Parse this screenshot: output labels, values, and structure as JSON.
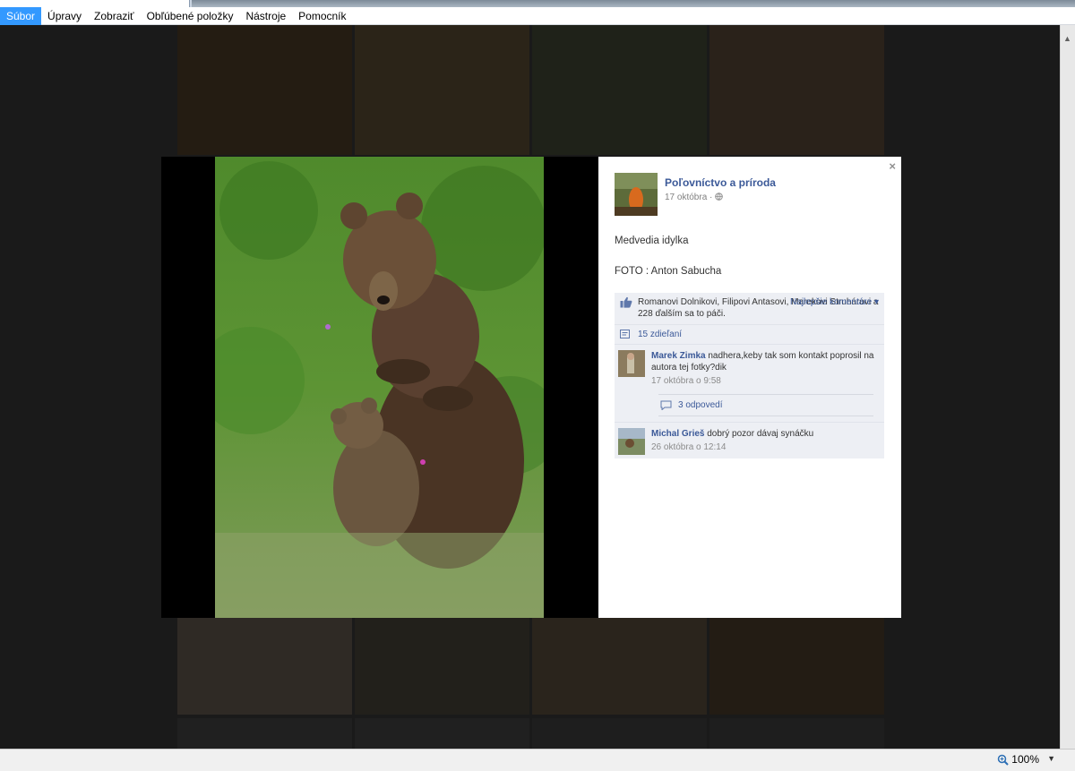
{
  "menu": {
    "items": [
      "Súbor",
      "Úpravy",
      "Zobraziť",
      "Obľúbené položky",
      "Nástroje",
      "Pomocník"
    ]
  },
  "viewer": {
    "close_label": "×",
    "author": {
      "name": "Poľovníctvo a príroda",
      "date": "17 októbra",
      "separator": "·"
    },
    "post": {
      "line1": "Medvedia idylka",
      "line2": "FOTO : Anton Sabucha"
    },
    "likes": {
      "text": "Romanovi Dolnikovi, Filipovi Antasovi, Marekovi Struhárovi a 228 ďalším sa to páči.",
      "best_comments": "Najlepšie komentáre ▾"
    },
    "shares": "15 zdieľaní",
    "comments": [
      {
        "author": "Marek Zimka",
        "text": "nadhera,keby tak som kontakt poprosil na autora tej fotky?dik",
        "time": "17 októbra o 9:58",
        "replies": "3 odpovedí"
      },
      {
        "author": "Michal Grieš",
        "text": "dobrý pozor dávaj synáčku",
        "time": "26 októbra o 12:14"
      }
    ]
  },
  "statusbar": {
    "zoom": "100%"
  },
  "colors": {
    "link": "#3b5998",
    "menu_active": "#3399ff",
    "ufi_bg": "#edeff4"
  }
}
